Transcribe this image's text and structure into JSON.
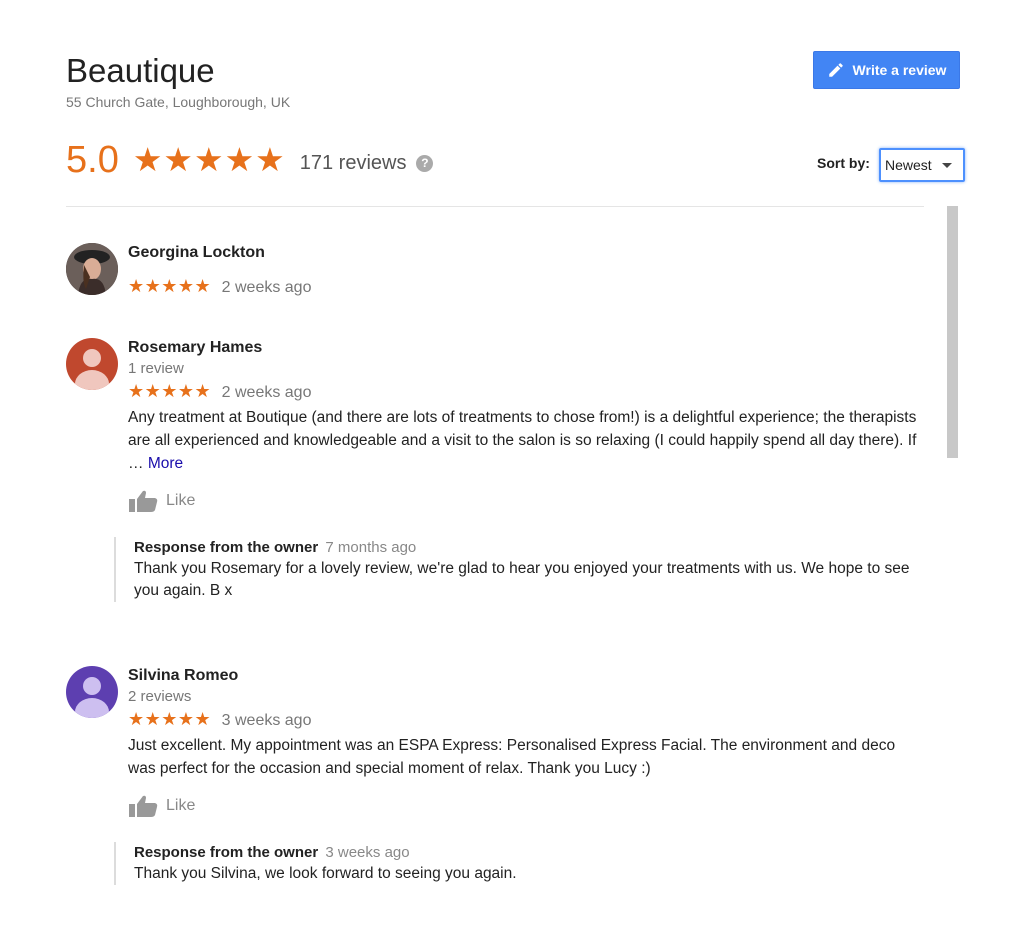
{
  "business": {
    "name": "Beautique",
    "address": "55 Church Gate, Loughborough, UK",
    "rating": "5.0",
    "stars": "★★★★★",
    "review_count": "171 reviews",
    "help_icon": "?"
  },
  "actions": {
    "write_review_label": "Write a review",
    "write_review_icon": "pencil-icon"
  },
  "sort": {
    "label": "Sort by:",
    "selected": "Newest"
  },
  "reviews": [
    {
      "author": "Georgina Lockton",
      "stars": "★★★★★",
      "date": "2 weeks ago"
    },
    {
      "author": "Rosemary Hames",
      "meta": "1 review",
      "stars": "★★★★★",
      "date": "2 weeks ago",
      "text": "Any treatment at Boutique (and there are lots of treatments to chose from!) is a delightful experience; the therapists are all experienced and knowledgeable and a visit to the salon is so relaxing (I could happily spend all day there).  If … ",
      "more": "More",
      "like": "Like",
      "response": {
        "label": "Response from the owner",
        "date": "7 months ago",
        "text": "Thank you Rosemary for a lovely review, we're glad to hear you enjoyed your treatments with us. We hope to see you again. B x"
      }
    },
    {
      "author": "Silvina Romeo",
      "meta": "2 reviews",
      "stars": "★★★★★",
      "date": "3 weeks ago",
      "text": "Just excellent. My appointment was an ESPA Express: Personalised Express Facial. The environment and deco was perfect for the occasion and special moment of relax. Thank you Lucy :)",
      "like": "Like",
      "response": {
        "label": "Response from the owner",
        "date": "3 weeks ago",
        "text": "Thank you Silvina, we look forward to seeing you again."
      }
    }
  ],
  "colors": {
    "accent": "#e7711b",
    "button": "#4285f4",
    "link": "#1a0dab"
  }
}
